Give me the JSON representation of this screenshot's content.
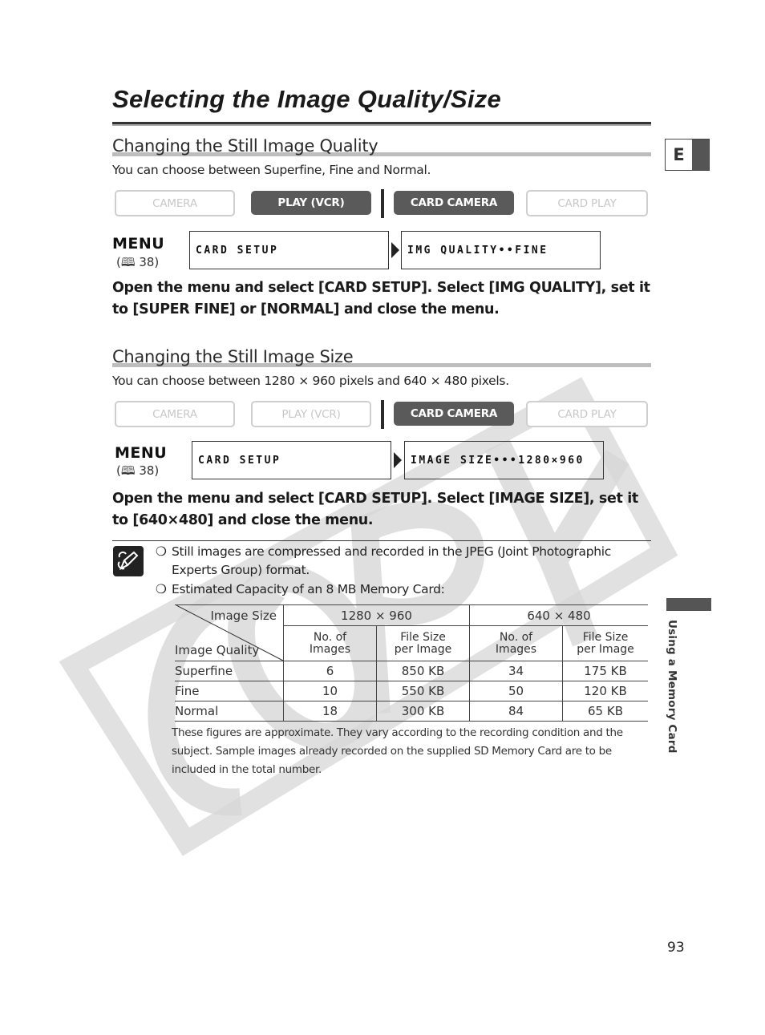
{
  "page": {
    "title": "Selecting the Image Quality/Size",
    "language_tab": "E",
    "side_label": "Using a Memory Card",
    "page_number": "93",
    "watermark": "COPY"
  },
  "section_quality": {
    "heading": "Changing the Still Image Quality",
    "intro": "You can choose between Superfine, Fine and Normal.",
    "modes": [
      {
        "label": "CAMERA",
        "active": false
      },
      {
        "label": "PLAY (VCR)",
        "active": true
      },
      {
        "label": "CARD CAMERA",
        "active": true
      },
      {
        "label": "CARD PLAY",
        "active": false
      }
    ],
    "menu_label": "MENU",
    "menu_ref": "( 38)",
    "lcd_menu": "CARD SETUP",
    "lcd_setting": "IMG QUALITY••FINE",
    "instruction": "Open the menu and select [CARD SETUP]. Select [IMG QUALITY], set it to [SUPER FINE] or [NORMAL] and close the menu."
  },
  "section_size": {
    "heading": "Changing the Still Image Size",
    "intro": "You can choose between 1280 × 960 pixels and 640 × 480 pixels.",
    "modes": [
      {
        "label": "CAMERA",
        "active": false
      },
      {
        "label": "PLAY (VCR)",
        "active": false
      },
      {
        "label": "CARD CAMERA",
        "active": true
      },
      {
        "label": "CARD PLAY",
        "active": false
      }
    ],
    "menu_label": "MENU",
    "menu_ref": "( 38)",
    "lcd_menu": "CARD SETUP",
    "lcd_setting": "IMAGE SIZE•••1280×960",
    "instruction": "Open the menu and select [CARD SETUP]. Select [IMAGE SIZE], set it to [640×480] and close the menu."
  },
  "notes": {
    "bullet_glyph": "❍",
    "items": [
      "Still images are compressed and recorded in the JPEG (Joint Photographic Experts Group) format.",
      "Estimated Capacity of an 8 MB Memory Card:"
    ],
    "footnote": "These figures are approximate. They vary according to the recording condition and the subject. Sample images already recorded on the supplied SD Memory Card are to be included in the total number."
  },
  "capacity_table": {
    "corner_top": "Image Size",
    "corner_bottom": "Image Quality",
    "size_groups": [
      "1280 × 960",
      "640 × 480"
    ],
    "sub_headers": [
      "No. of\nImages",
      "File Size\nper Image",
      "No. of\nImages",
      "File Size\nper Image"
    ],
    "rows": [
      {
        "quality": "Superfine",
        "values": [
          "6",
          "850 KB",
          "34",
          "175 KB"
        ]
      },
      {
        "quality": "Fine",
        "values": [
          "10",
          "550 KB",
          "50",
          "120 KB"
        ]
      },
      {
        "quality": "Normal",
        "values": [
          "18",
          "300 KB",
          "84",
          "65 KB"
        ]
      }
    ]
  },
  "colors": {
    "active_mode": "#5a5a5a",
    "inactive_mode_border": "#cfcfcf",
    "watermark": "#d9d9d9",
    "tab_dark": "#555555"
  }
}
